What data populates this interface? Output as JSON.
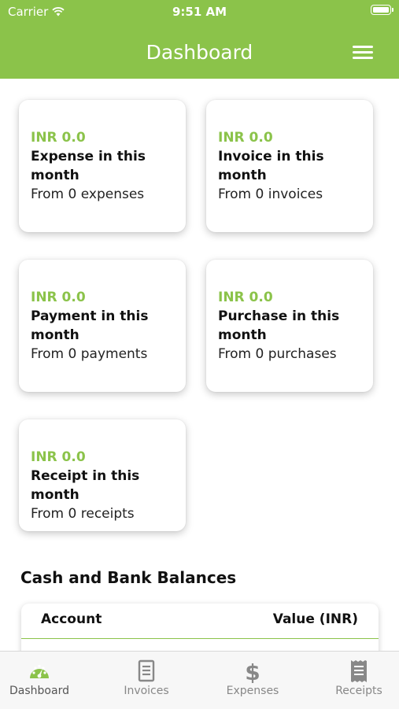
{
  "status_bar": {
    "carrier": "Carrier",
    "time": "9:51 AM"
  },
  "header": {
    "title": "Dashboard",
    "menu_icon": "hamburger-menu-icon"
  },
  "colors": {
    "accent": "#8bc34a",
    "tab_inactive": "#888888",
    "tab_active_icon": "#8bc34a"
  },
  "cards": [
    {
      "amount": "INR 0.0",
      "label": "Expense in this month",
      "sub": "From 0 expenses"
    },
    {
      "amount": "INR 0.0",
      "label": "Invoice in this month",
      "sub": "From 0 invoices"
    },
    {
      "amount": "INR 0.0",
      "label": "Payment in this month",
      "sub": "From 0 payments"
    },
    {
      "amount": "INR 0.0",
      "label": "Purchase in this month",
      "sub": "From 0 purchases"
    },
    {
      "amount": "INR 0.0",
      "label": "Receipt in this month",
      "sub": "From 0 receipts"
    }
  ],
  "balances": {
    "title": "Cash and Bank Balances",
    "columns": [
      "Account",
      "Value (INR)"
    ]
  },
  "tabs": [
    {
      "label": "Dashboard",
      "icon": "speedometer-icon",
      "active": true
    },
    {
      "label": "Invoices",
      "icon": "document-icon",
      "active": false
    },
    {
      "label": "Expenses",
      "icon": "dollar-icon",
      "active": false
    },
    {
      "label": "Receipts",
      "icon": "receipt-icon",
      "active": false
    }
  ]
}
